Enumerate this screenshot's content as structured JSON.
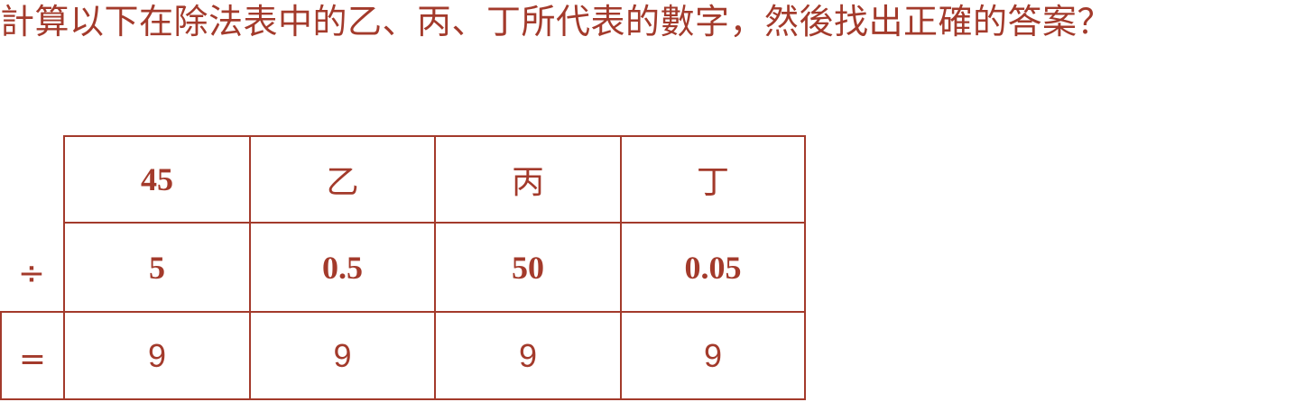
{
  "question": "計算以下在除法表中的乙、丙、丁所代表的數字，然後找出正確的答案？",
  "division_table": {
    "operators": {
      "divide": "÷",
      "equals": "="
    },
    "dividends": [
      "45",
      "乙",
      "丙",
      "丁"
    ],
    "divisors": [
      "5",
      "0.5",
      "50",
      "0.05"
    ],
    "quotients": [
      "9",
      "9",
      "9",
      "9"
    ]
  }
}
